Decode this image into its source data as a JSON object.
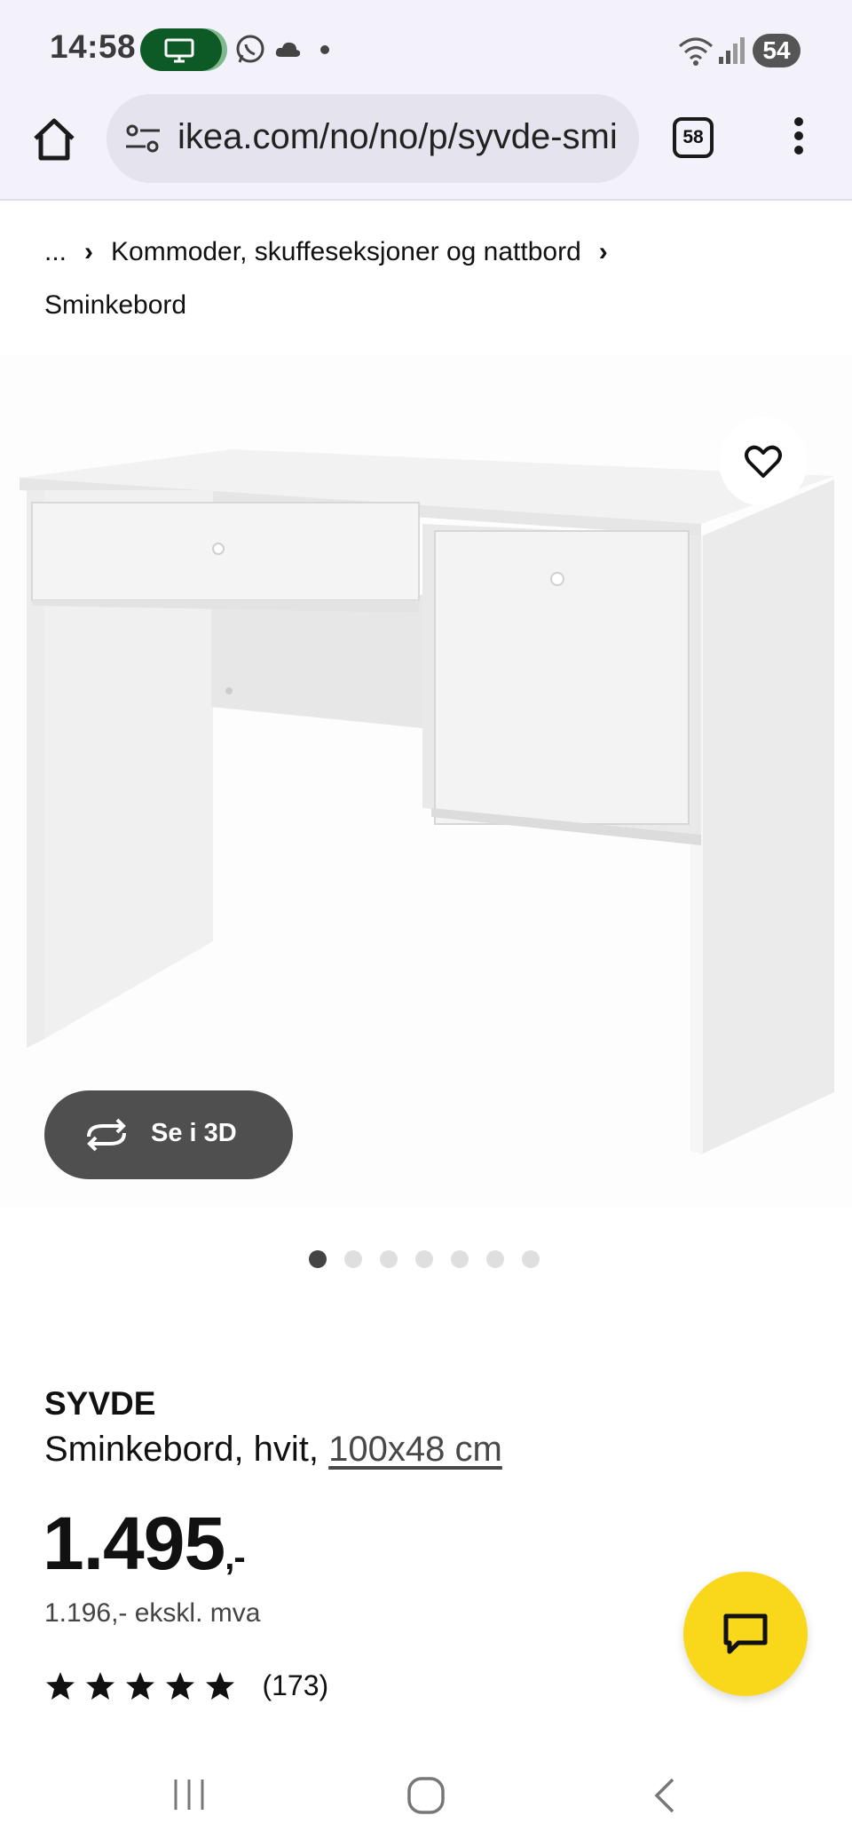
{
  "status_bar": {
    "time": "14:58",
    "icons": [
      "screen-cast-icon",
      "whatsapp-icon",
      "cloud-icon",
      "dot-icon",
      "wifi-icon",
      "signal-icon"
    ],
    "battery": "54"
  },
  "browser": {
    "url": "ikea.com/no/no/p/syvde-smi",
    "tab_count": "58"
  },
  "breadcrumb": {
    "ellipsis": "...",
    "category": "Kommoder, skuffeseksjoner og nattbord",
    "current": "Sminkebord"
  },
  "gallery": {
    "view_3d_label": "Se i 3D",
    "image_count": 7,
    "active_index": 0
  },
  "product": {
    "name": "SYVDE",
    "description": "Sminkebord, hvit,",
    "size_link": "100x48 cm",
    "price": "1.495",
    "price_suffix": ",-",
    "price_ex_vat": "1.196,- ekskl. mva",
    "rating_stars": 5,
    "rating_count": "(173)"
  },
  "colors": {
    "accent_yellow": "#f9d81b",
    "chrome_bg": "#f3f2fa",
    "dark_button": "#4f4f4f"
  }
}
